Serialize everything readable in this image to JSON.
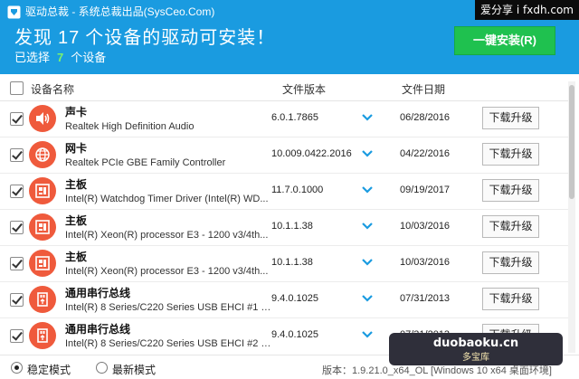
{
  "app": {
    "title": "驱动总裁 - 系统总裁出品(SysCeo.Com)",
    "corner_watermark": "爱分享 i fxdh.com"
  },
  "summary": {
    "headline_prefix": "发现",
    "found_count": "17",
    "headline_suffix": "个设备的驱动可安装！",
    "selected_prefix": "已选择",
    "selected_count": "7",
    "selected_suffix": "个设备",
    "install_all_label": "一键安装(R)"
  },
  "columns": {
    "name": "设备名称",
    "version": "文件版本",
    "date": "文件日期"
  },
  "devices": [
    {
      "name": "声卡",
      "desc": "Realtek High Definition Audio",
      "version": "6.0.1.7865",
      "date": "06/28/2016",
      "button": "下载升级",
      "icon": "speaker-icon"
    },
    {
      "name": "网卡",
      "desc": "Realtek PCIe GBE Family Controller",
      "version": "10.009.0422.2016",
      "date": "04/22/2016",
      "button": "下载升级",
      "icon": "globe-icon"
    },
    {
      "name": "主板",
      "desc": "Intel(R) Watchdog Timer Driver (Intel(R) WD...",
      "version": "11.7.0.1000",
      "date": "09/19/2017",
      "button": "下载升级",
      "icon": "motherboard-icon"
    },
    {
      "name": "主板",
      "desc": "Intel(R) Xeon(R) processor E3 - 1200 v3/4th...",
      "version": "10.1.1.38",
      "date": "10/03/2016",
      "button": "下载升级",
      "icon": "motherboard-icon"
    },
    {
      "name": "主板",
      "desc": "Intel(R) Xeon(R) processor E3 - 1200 v3/4th...",
      "version": "10.1.1.38",
      "date": "10/03/2016",
      "button": "下载升级",
      "icon": "motherboard-icon"
    },
    {
      "name": "通用串行总线",
      "desc": "Intel(R) 8 Series/C220 Series USB EHCI #1 -...",
      "version": "9.4.0.1025",
      "date": "07/31/2013",
      "button": "下载升级",
      "icon": "usb-icon"
    },
    {
      "name": "通用串行总线",
      "desc": "Intel(R) 8 Series/C220 Series USB EHCI #2 -...",
      "version": "9.4.0.1025",
      "date": "07/31/2013",
      "button": "下载升级",
      "icon": "usb-icon"
    }
  ],
  "footer": {
    "mode_stable": "稳定模式",
    "mode_latest": "最新模式",
    "version_text": "版本：1.9.21.0_x64_OL [Windows 10 x64 桌面环境]"
  },
  "watermark": {
    "site": "duobaoku.cn",
    "name": "多宝库"
  },
  "colors": {
    "header_bg": "#1a9be0",
    "install_button": "#1fc14f",
    "device_icon": "#ef5a3c",
    "count_highlight": "#7cf36d"
  }
}
